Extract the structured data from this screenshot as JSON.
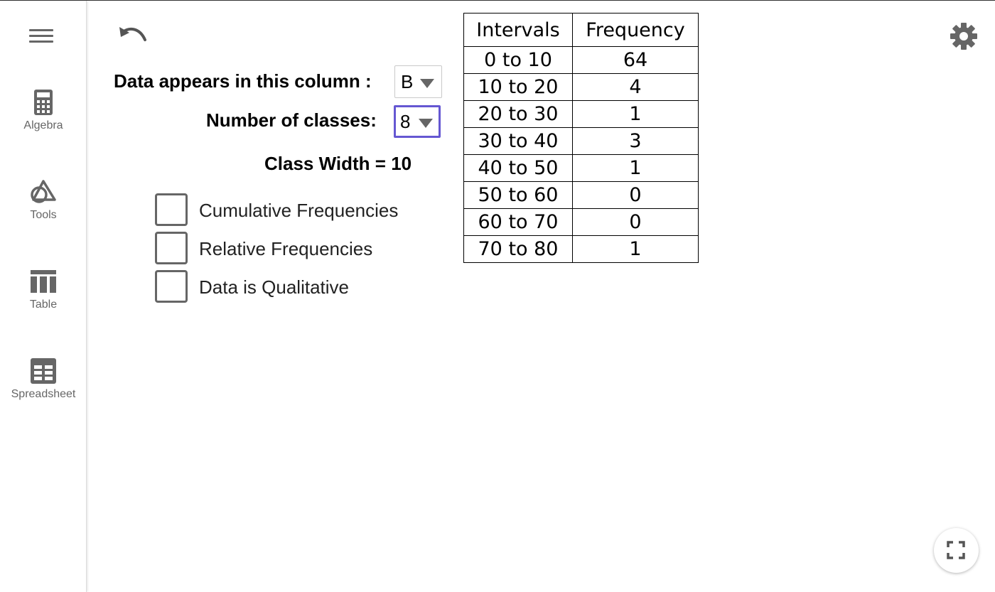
{
  "sidebar": {
    "items": [
      {
        "label": "Algebra",
        "icon": "calculator-icon"
      },
      {
        "label": "Tools",
        "icon": "shapes-icon"
      },
      {
        "label": "Table",
        "icon": "table-icon"
      },
      {
        "label": "Spreadsheet",
        "icon": "spreadsheet-icon"
      }
    ]
  },
  "controls": {
    "column_label": "Data appears in this column :",
    "column_value": "B",
    "classes_label": "Number of classes:",
    "classes_value": "8",
    "class_width_text": "Class Width = 10"
  },
  "checkboxes": [
    {
      "label": "Cumulative Frequencies",
      "checked": false
    },
    {
      "label": "Relative Frequencies",
      "checked": false
    },
    {
      "label": "Data is Qualitative",
      "checked": false
    }
  ],
  "table": {
    "headers": [
      "Intervals",
      "Frequency"
    ],
    "rows": [
      [
        "0 to 10",
        "64"
      ],
      [
        "10 to 20",
        "4"
      ],
      [
        "20 to 30",
        "1"
      ],
      [
        "30 to 40",
        "3"
      ],
      [
        "40 to 50",
        "1"
      ],
      [
        "50 to 60",
        "0"
      ],
      [
        "60 to 70",
        "0"
      ],
      [
        "70 to 80",
        "1"
      ]
    ]
  },
  "colors": {
    "focus_accent": "#6557d2",
    "icon_gray": "#666666"
  }
}
